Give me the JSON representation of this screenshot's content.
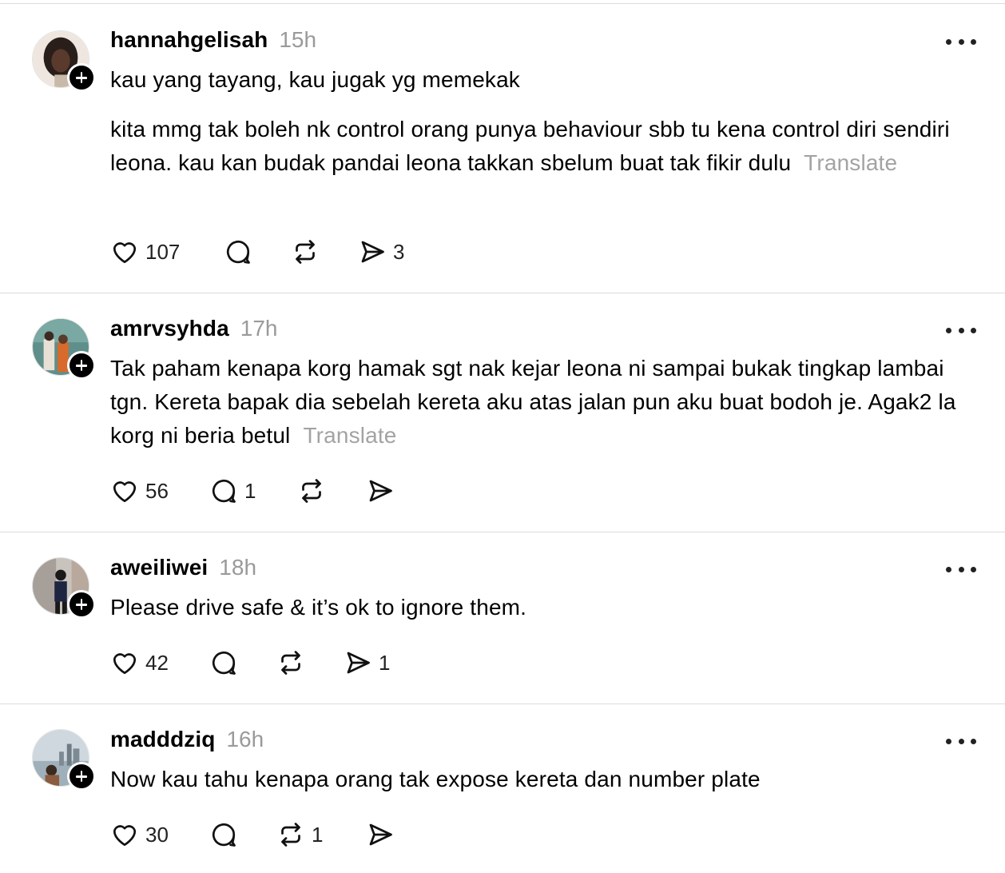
{
  "posts": [
    {
      "username": "hannahgelisah",
      "time": "15h",
      "paragraphs": [
        "kau yang tayang, kau jugak yg memekak",
        "kita mmg tak boleh nk control orang punya behaviour sbb tu kena control diri sendiri leona. kau kan budak pandai leona takkan sbelum buat tak fikir dulu"
      ],
      "translate_label": "Translate",
      "likes": "107",
      "replies": "",
      "reposts": "",
      "shares": "3"
    },
    {
      "username": "amrvsyhda",
      "time": "17h",
      "paragraphs": [
        "Tak paham kenapa korg hamak sgt nak kejar leona ni sampai bukak tingkap lambai tgn. Kereta bapak dia sebelah kereta aku atas jalan pun aku buat bodoh je. Agak2 la korg ni beria betul"
      ],
      "translate_label": "Translate",
      "likes": "56",
      "replies": "1",
      "reposts": "",
      "shares": ""
    },
    {
      "username": "aweiliwei",
      "time": "18h",
      "paragraphs": [
        "Please drive safe & it’s ok to ignore them."
      ],
      "translate_label": "",
      "likes": "42",
      "replies": "",
      "reposts": "",
      "shares": "1"
    },
    {
      "username": "madddziq",
      "time": "16h",
      "paragraphs": [
        "Now kau tahu kenapa orang tak expose kereta dan number plate"
      ],
      "translate_label": "",
      "likes": "30",
      "replies": "",
      "reposts": "1",
      "shares": ""
    }
  ],
  "icons": {
    "like": "heart-icon",
    "reply": "speech-bubble-icon",
    "repost": "repost-arrows-icon",
    "share": "paper-plane-icon",
    "more": "ellipsis-icon",
    "follow": "plus-icon"
  },
  "colors": {
    "text": "#000000",
    "muted": "#9a9a9a",
    "divider": "#dcdcdc"
  }
}
